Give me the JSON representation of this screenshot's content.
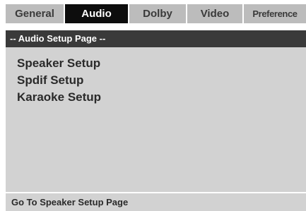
{
  "tabs": [
    {
      "label": "General",
      "active": false
    },
    {
      "label": "Audio",
      "active": true
    },
    {
      "label": "Dolby",
      "active": false
    },
    {
      "label": "Video",
      "active": false
    },
    {
      "label": "Preference",
      "active": false
    }
  ],
  "page": {
    "header": "-- Audio Setup Page --"
  },
  "menu": {
    "items": [
      {
        "label": "Speaker Setup"
      },
      {
        "label": "Spdif Setup"
      },
      {
        "label": "Karaoke Setup"
      }
    ]
  },
  "footer": {
    "hint": "Go To Speaker Setup Page"
  },
  "colors": {
    "tab_bar": "#bcbcbc",
    "active_tab": "#0d0d0d",
    "header_bar": "#3a3a3a",
    "content_bg": "#d2d2d2",
    "text": "#2a2a2a"
  }
}
